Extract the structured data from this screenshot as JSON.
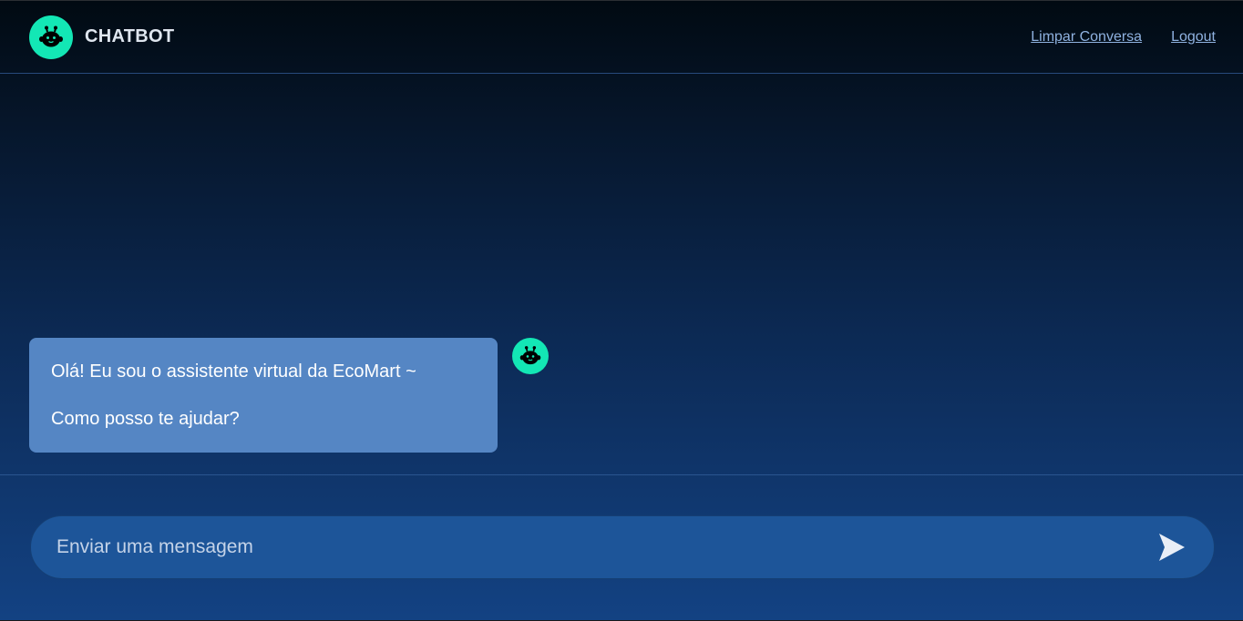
{
  "header": {
    "brand": "CHATBOT",
    "logo_icon": "robot-icon",
    "nav": {
      "clear": "Limpar Conversa",
      "logout": "Logout"
    }
  },
  "chat": {
    "messages": [
      {
        "sender": "bot",
        "avatar_icon": "robot-icon",
        "lines": [
          "Olá! Eu sou o assistente virtual da EcoMart ~",
          "Como posso te ajudar?"
        ]
      }
    ]
  },
  "composer": {
    "placeholder": "Enviar uma mensagem",
    "value": "",
    "send_icon": "send-icon"
  },
  "colors": {
    "accent": "#13e7b5",
    "bubble": "#5586c4",
    "input_bg": "#1d5599",
    "link": "#8fb2e0"
  }
}
